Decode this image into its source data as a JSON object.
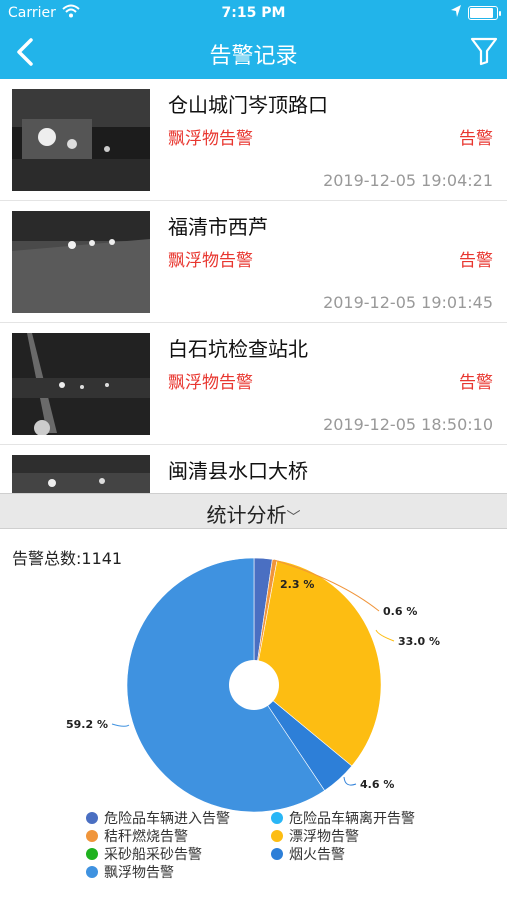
{
  "status": {
    "carrier": "Carrier",
    "time": "7:15 PM",
    "battery_level": 0.9
  },
  "header": {
    "title": "告警记录"
  },
  "alarms": [
    {
      "location": "仓山城门岑顶路口",
      "type": "飘浮物告警",
      "tag": "告警",
      "time": "2019-12-05 19:04:21"
    },
    {
      "location": "福清市西芦",
      "type": "飘浮物告警",
      "tag": "告警",
      "time": "2019-12-05 19:01:45"
    },
    {
      "location": "白石坑检查站北",
      "type": "飘浮物告警",
      "tag": "告警",
      "time": "2019-12-05 18:50:10"
    },
    {
      "location": "闽清县水口大桥",
      "type": "",
      "tag": "",
      "time": ""
    }
  ],
  "stats": {
    "section_label": "统计分析",
    "total_label": "告警总数:1141"
  },
  "chart_data": {
    "type": "pie",
    "donut": true,
    "title": "",
    "slices": [
      {
        "name": "危险品车辆进入告警",
        "value": 2.3,
        "label": "",
        "color": "#4a6fc2"
      },
      {
        "name": "危险品车辆离开告警",
        "value": 0.0,
        "label": "",
        "color": "#29b6f6"
      },
      {
        "name": "秸秆燃烧告警",
        "value": 0.6,
        "label": "0.6 %",
        "color": "#f0953b"
      },
      {
        "name": "漂浮物告警",
        "value": 33.0,
        "label": "33.0 %",
        "color": "#fdbd12"
      },
      {
        "name": "采砂船采砂告警",
        "value": 0.0,
        "label": "",
        "color": "#1fb21f"
      },
      {
        "name": "烟火告警",
        "value": 4.6,
        "label": "4.6 %",
        "color": "#2d7fd8"
      },
      {
        "name": "飘浮物告警",
        "value": 59.2,
        "label": "59.2 %",
        "color": "#3f92e0"
      }
    ],
    "extra_labels": [
      "2.3 %"
    ],
    "legend_position": "bottom"
  }
}
